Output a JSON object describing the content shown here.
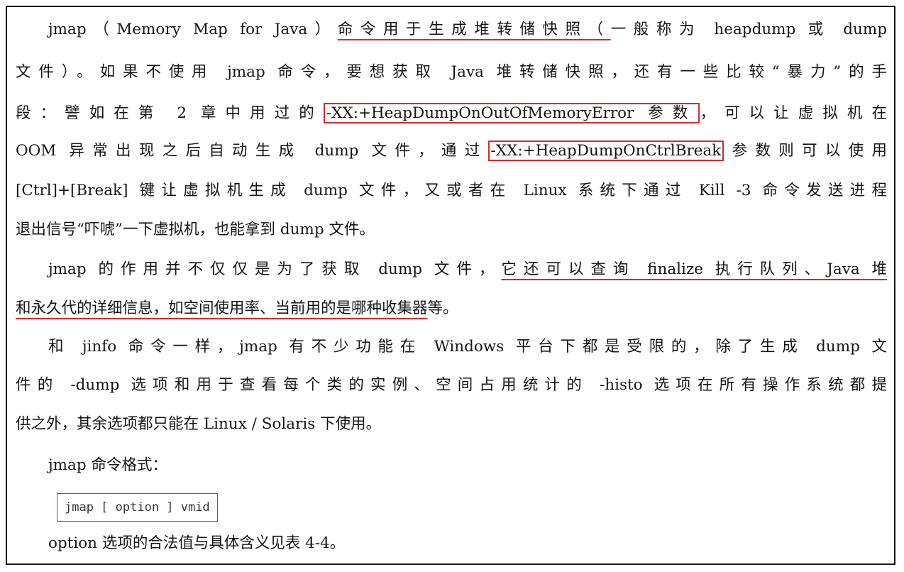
{
  "colors": {
    "annotation": "#d12b2b",
    "text": "#151515",
    "border": "#1a1a1a"
  },
  "paragraph1": {
    "line1": {
      "a": "jmap（Memory Map for Java）",
      "b": "命令用于生成堆转储快照（",
      "c": "一般称为 heapdump 或 dump"
    },
    "line2": "文件）。如果不使用 jmap 命令，要想获取 Java 堆转储快照，还有一些比较“暴力”的手",
    "line3": {
      "a": "段：譬如在第 2 章中用过的",
      "b": "-XX:+HeapDumpOnOutOfMemoryError 参数",
      "c": "，可以让虚拟机在"
    },
    "line4": {
      "a": "OOM 异常出现之后自动生成 dump 文件，通过",
      "b": "-XX:+HeapDumpOnCtrlBreak",
      "c": "参数则可以使用"
    },
    "line5": "[Ctrl]+[Break] 键让虚拟机生成 dump 文件，又或者在 Linux 系统下通过 Kill -3 命令发送进程",
    "line6": "退出信号“吓唬”一下虚拟机，也能拿到 dump 文件。"
  },
  "paragraph2": {
    "line1": {
      "a": "jmap 的作用并不仅仅是为了获取 dump 文件，",
      "b": "它还可以查询 finalize 执行队列、Java 堆"
    },
    "line2": {
      "a": "和永久代的详细信息，如空间使用率、当前用的是哪种收集器",
      "b": "等。"
    }
  },
  "paragraph3": {
    "line1": "和 jinfo 命令一样，jmap 有不少功能在 Windows 平台下都是受限的，除了生成 dump 文",
    "line2": "件的 -dump 选项和用于查看每个类的实例、空间占用统计的 -histo 选项在所有操作系统都提",
    "line3": "供之外，其余选项都只能在 Linux / Solaris 下使用。"
  },
  "format_label": "jmap 命令格式：",
  "command": "jmap [ option ] vmid",
  "closing": "option 选项的合法值与具体含义见表 4-4。"
}
